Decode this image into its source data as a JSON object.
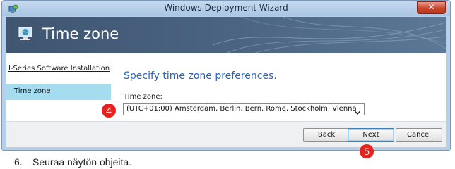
{
  "window": {
    "title": "Windows Deployment Wizard",
    "close_glyph": "✕"
  },
  "banner": {
    "title": "Time zone"
  },
  "sidebar": {
    "items": [
      {
        "label": "I-Series Software Installation",
        "state": "link"
      },
      {
        "label": "Time zone",
        "state": "active"
      }
    ]
  },
  "main": {
    "heading": "Specify time zone preferences.",
    "timezone_label": "Time zone:",
    "timezone_value": "(UTC+01:00) Amsterdam, Berlin, Bern, Rome, Stockholm, Vienna"
  },
  "footer": {
    "back_label": "Back",
    "next_label": "Next",
    "cancel_label": "Cancel"
  },
  "callouts": {
    "timezone": "4",
    "next": "5"
  },
  "instruction": {
    "number": "6.",
    "text": "Seuraa näytön ohjeita."
  },
  "colors": {
    "accent_heading": "#2a64b0",
    "selection": "#a5dcef",
    "callout": "#e8211d",
    "banner": "#4b6583"
  },
  "icons": [
    "wizard-app-icon",
    "close-icon",
    "monitor-globe-icon",
    "chevron-down-icon"
  ]
}
